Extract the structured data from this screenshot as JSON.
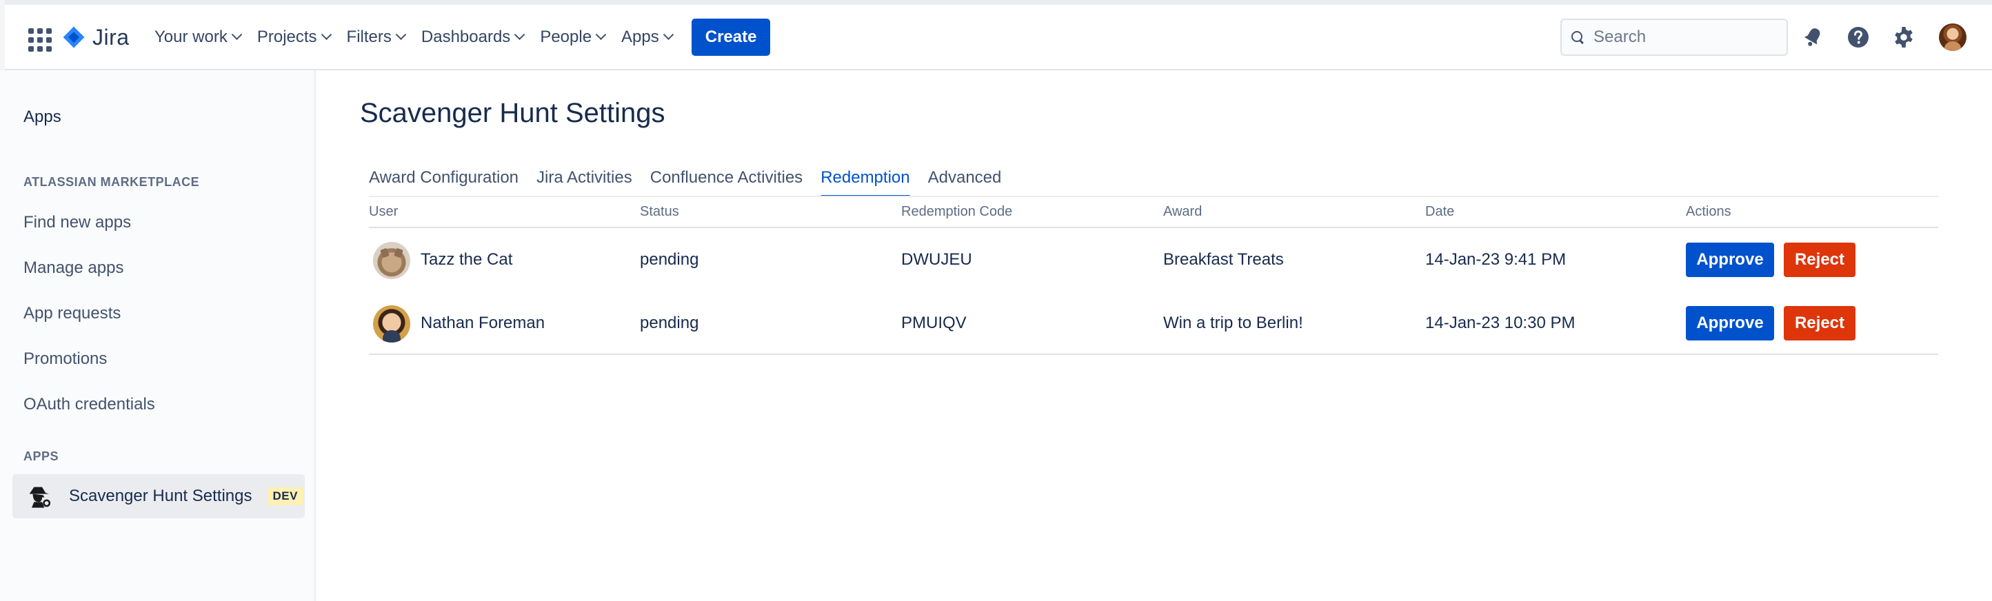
{
  "app": {
    "name": "Jira"
  },
  "nav": {
    "items": [
      {
        "label": "Your work"
      },
      {
        "label": "Projects"
      },
      {
        "label": "Filters"
      },
      {
        "label": "Dashboards"
      },
      {
        "label": "People"
      },
      {
        "label": "Apps"
      }
    ],
    "create_label": "Create",
    "search_placeholder": "Search",
    "icons": [
      "notifications-icon",
      "help-icon",
      "settings-icon",
      "profile-avatar"
    ]
  },
  "sidebar": {
    "title": "Apps",
    "marketplace_section": "ATLASSIAN MARKETPLACE",
    "marketplace_links": [
      {
        "label": "Find new apps"
      },
      {
        "label": "Manage apps"
      },
      {
        "label": "App requests"
      },
      {
        "label": "Promotions"
      },
      {
        "label": "OAuth credentials"
      }
    ],
    "apps_section": "APPS",
    "app_item": {
      "label": "Scavenger Hunt Settings",
      "badge": "DEV",
      "icon": "detective-icon"
    }
  },
  "main": {
    "title": "Scavenger Hunt Settings",
    "tabs": [
      {
        "label": "Award Configuration"
      },
      {
        "label": "Jira Activities"
      },
      {
        "label": "Confluence Activities"
      },
      {
        "label": "Redemption",
        "active": true
      },
      {
        "label": "Advanced"
      }
    ],
    "table": {
      "columns": [
        "User",
        "Status",
        "Redemption Code",
        "Award",
        "Date",
        "Actions"
      ],
      "rows": [
        {
          "user": "Tazz the Cat",
          "status": "pending",
          "code": "DWUJEU",
          "award": "Breakfast Treats",
          "date": "14-Jan-23 9:41 PM",
          "approve": "Approve",
          "reject": "Reject"
        },
        {
          "user": "Nathan Foreman",
          "status": "pending",
          "code": "PMUIQV",
          "award": "Win a trip to Berlin!",
          "date": "14-Jan-23 10:30 PM",
          "approve": "Approve",
          "reject": "Reject"
        }
      ]
    }
  },
  "colors": {
    "primary": "#0052cc",
    "danger": "#de350b",
    "text": "#172b4d",
    "badge_bg": "#fff0b3"
  }
}
